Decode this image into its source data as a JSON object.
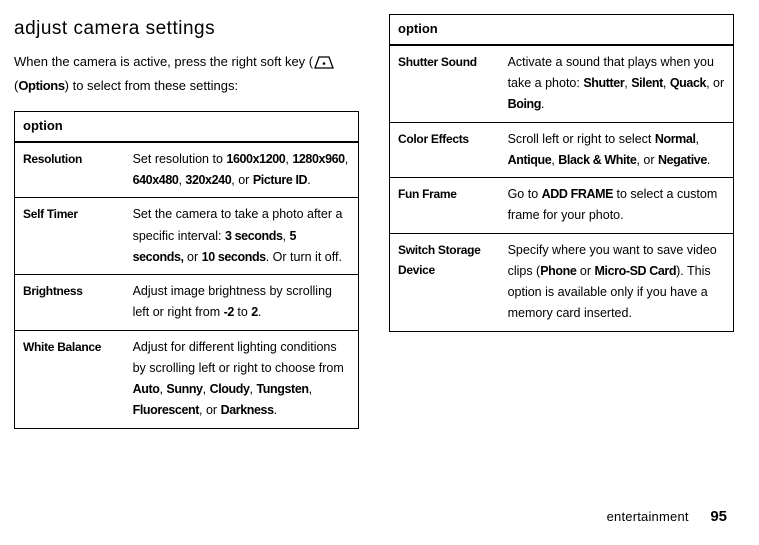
{
  "title": "adjust camera settings",
  "intro": {
    "part1": "When the camera is active, press the right soft key (",
    "options_label": "Options",
    "part2": ") to select from these settings:"
  },
  "table_header": "option",
  "rows_left": [
    {
      "name": "Resolution",
      "desc_parts": [
        "Set resolution to ",
        "1600x1200",
        ", ",
        "1280x960",
        ", ",
        "640x480",
        ", ",
        "320x240",
        ", or ",
        "Picture ID",
        "."
      ]
    },
    {
      "name": "Self Timer",
      "desc_parts": [
        "Set the camera to take a photo after a specific interval: ",
        "3 seconds",
        ", ",
        "5 seconds,",
        " or ",
        "10 seconds",
        ". Or turn it off."
      ]
    },
    {
      "name": "Brightness",
      "desc_parts": [
        "Adjust image brightness by scrolling left or right from ",
        "-2",
        " to ",
        "2",
        "."
      ]
    },
    {
      "name": "White Balance",
      "desc_parts": [
        "Adjust for different lighting conditions by scrolling left or right to choose from ",
        "Auto",
        ", ",
        "Sunny",
        ", ",
        "Cloudy",
        ", ",
        "Tungsten",
        ", ",
        "Fluorescent",
        ", or ",
        "Darkness",
        "."
      ]
    }
  ],
  "rows_right": [
    {
      "name": "Shutter Sound",
      "desc_parts": [
        "Activate a sound that plays when you take a photo: ",
        "Shutter",
        ", ",
        "Silent",
        ", ",
        "Quack",
        ", or ",
        "Boing",
        "."
      ]
    },
    {
      "name": "Color Effects",
      "desc_parts": [
        "Scroll left or right to select ",
        "Normal",
        ", ",
        "Antique",
        ", ",
        "Black & White",
        ", or ",
        "Negative",
        "."
      ]
    },
    {
      "name": "Fun Frame",
      "desc_parts": [
        "Go to ",
        "ADD FRAME",
        " to select a custom frame for your photo."
      ]
    },
    {
      "name": "Switch Storage Device",
      "desc_parts": [
        "Specify where you want to save video clips (",
        "Phone",
        " or ",
        "Micro-SD Card",
        "). This option is available only if you have a memory card inserted."
      ]
    }
  ],
  "footer": {
    "section": "entertainment",
    "page": "95"
  }
}
